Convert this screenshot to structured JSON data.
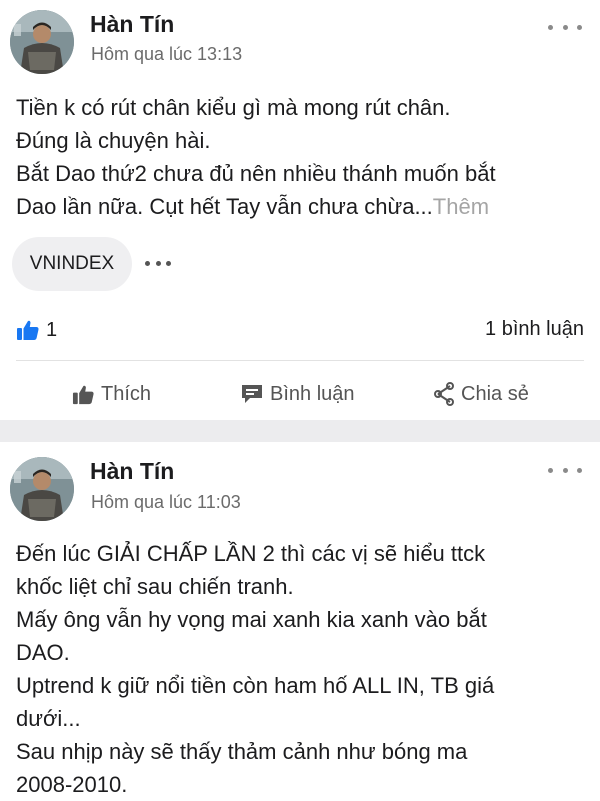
{
  "posts": [
    {
      "author": "Hàn Tín",
      "time": "Hôm qua lúc 13:13",
      "lines": [
        "Tiền k có rút chân kiểu gì mà mong rút chân.",
        "Đúng là chuyện hài.",
        "Bắt Dao thứ2 chưa đủ nên nhiều thánh muốn bắt",
        "Dao lần nữa. Cụt hết Tay vẫn chưa chừa..."
      ],
      "more_label": "Thêm",
      "tag": "VNINDEX",
      "like_count": "1",
      "comment_count": "1 bình luận",
      "actions": {
        "like": "Thích",
        "comment": "Bình luận",
        "share": "Chia sẻ"
      }
    },
    {
      "author": "Hàn Tín",
      "time": "Hôm qua lúc 11:03",
      "lines": [
        "Đến lúc GIẢI CHẤP LẦN 2 thì các vị sẽ hiểu ttck",
        "khốc liệt chỉ sau chiến tranh.",
        "Mấy ông vẫn hy vọng mai xanh kia xanh vào bắt",
        "DAO.",
        "Uptrend k giữ nổi tiền còn ham hố ALL IN, TB giá",
        "dưới...",
        "Sau nhịp này sẽ thấy thảm cảnh như bóng ma",
        "2008-2010."
      ]
    }
  ],
  "icons": {
    "like_badge": "thumbs-up-icon",
    "like": "thumbs-up-icon",
    "comment": "comment-icon",
    "share": "share-icon",
    "more": "more-options-icon"
  },
  "colors": {
    "like_blue": "#1877f2",
    "separator": "#ececee",
    "secondary_text": "#6b6b6b",
    "more_link": "#a5a5a5"
  }
}
